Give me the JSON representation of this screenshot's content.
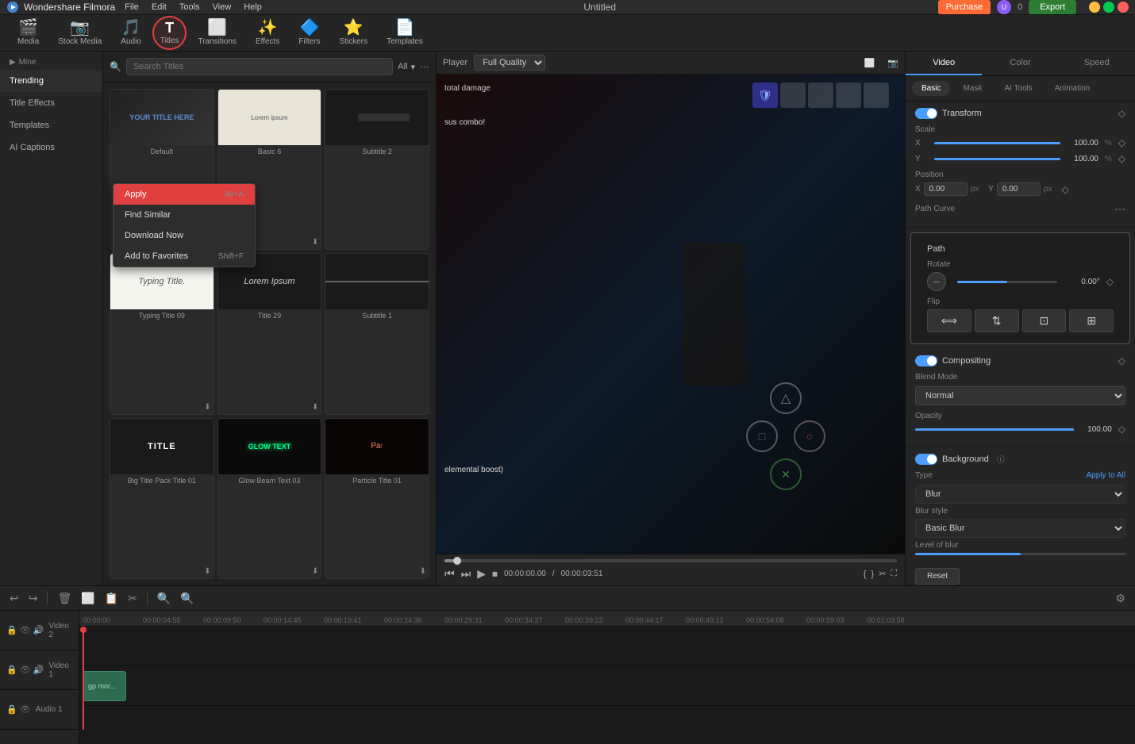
{
  "app": {
    "name": "Wondershare Filmora",
    "title": "Untitled",
    "purchase_label": "Purchase",
    "export_label": "Export"
  },
  "topbar_menus": [
    "File",
    "Edit",
    "Tools",
    "View",
    "Help"
  ],
  "toolbar": {
    "items": [
      {
        "id": "media",
        "label": "Media",
        "icon": "🎬"
      },
      {
        "id": "stock",
        "label": "Stock Media",
        "icon": "📷"
      },
      {
        "id": "audio",
        "label": "Audio",
        "icon": "🎵"
      },
      {
        "id": "titles",
        "label": "Titles",
        "icon": "T",
        "active": true
      },
      {
        "id": "transitions",
        "label": "Transitions",
        "icon": "⬛"
      },
      {
        "id": "effects",
        "label": "Effects",
        "icon": "✨"
      },
      {
        "id": "filters",
        "label": "Filters",
        "icon": "🔷"
      },
      {
        "id": "stickers",
        "label": "Stickers",
        "icon": "⭐"
      },
      {
        "id": "templates",
        "label": "Templates",
        "icon": "📄"
      }
    ]
  },
  "left_panel": {
    "sections": [
      {
        "id": "mine",
        "label": "Mine",
        "expandable": true
      },
      {
        "id": "trending",
        "label": "Trending",
        "active": true
      },
      {
        "id": "title_effects",
        "label": "Title Effects"
      },
      {
        "id": "title_templates",
        "label": "Templates"
      },
      {
        "id": "ai_captions",
        "label": "AI Captions"
      }
    ]
  },
  "titles_panel": {
    "search_placeholder": "Search Titles",
    "filter_label": "All",
    "cards": [
      {
        "id": "default",
        "label": "Default",
        "type": "default"
      },
      {
        "id": "basic6",
        "label": "Basic 6",
        "type": "basic6"
      },
      {
        "id": "subtitle2",
        "label": "Subtitle 2",
        "type": "subtitle2"
      },
      {
        "id": "typing09",
        "label": "Typing Title 09",
        "type": "typing"
      },
      {
        "id": "title29",
        "label": "Title 29",
        "type": "title29"
      },
      {
        "id": "subtitle1",
        "label": "Subtitle 1",
        "type": "subtitle1"
      },
      {
        "id": "big_title01",
        "label": "Big Title Pack Title 01",
        "type": "bigTitle"
      },
      {
        "id": "glow_beam03",
        "label": "Glow Beam Text 03",
        "type": "glow"
      },
      {
        "id": "particle01",
        "label": "Particle Title 01",
        "type": "particle"
      }
    ]
  },
  "context_menu": {
    "items": [
      {
        "id": "apply",
        "label": "Apply",
        "shortcut": "Alt+A",
        "style": "primary"
      },
      {
        "id": "find_similar",
        "label": "Find Similar",
        "shortcut": ""
      },
      {
        "id": "download",
        "label": "Download Now",
        "shortcut": ""
      },
      {
        "id": "favorites",
        "label": "Add to Favorites",
        "shortcut": "Shift+F"
      }
    ]
  },
  "player": {
    "label": "Player",
    "quality": "Full Quality",
    "current_time": "00:00:00.00",
    "total_time": "00:00:03:51"
  },
  "right_panel": {
    "tabs": [
      "Video",
      "Color",
      "Speed"
    ],
    "active_tab": "Video",
    "sub_tabs": [
      "Basic",
      "Mask",
      "AI Tools",
      "Animation"
    ],
    "active_sub_tab": "Basic",
    "transform": {
      "title": "Transform",
      "scale": {
        "label": "Scale",
        "x_label": "X",
        "x_value": "100.00",
        "x_unit": "%",
        "y_label": "Y",
        "y_value": "100.00",
        "y_unit": "%"
      },
      "position": {
        "label": "Position",
        "x_label": "X",
        "x_value": "0.00",
        "x_unit": "px",
        "y_label": "Y",
        "y_value": "0.00",
        "y_unit": "px"
      },
      "path_curve_label": "Path Curve"
    },
    "path_section": {
      "title": "Path",
      "rotate": {
        "label": "Rotate",
        "value": "0.00°"
      },
      "flip_label": "Flip"
    },
    "compositing": {
      "title": "Compositing",
      "blend_mode_label": "Blend Mode",
      "blend_mode_value": "Normal",
      "opacity_label": "Opacity",
      "opacity_value": "100.00"
    },
    "background": {
      "title": "Background",
      "enabled": true,
      "type_label": "Type",
      "apply_all_label": "Apply to All",
      "type_value": "Blur",
      "blur_style_label": "Blur style",
      "blur_style_value": "Basic Blur",
      "blur_level_label": "Level of blur",
      "reset_label": "Reset"
    }
  },
  "timeline": {
    "tracks": [
      {
        "id": "video2",
        "label": "Video 2",
        "clips": []
      },
      {
        "id": "video1",
        "label": "Video 1",
        "clips": [
          {
            "label": "gp mor...",
            "start": 0,
            "width": 60
          }
        ]
      },
      {
        "id": "audio1",
        "label": "Audio 1",
        "clips": []
      }
    ],
    "time_markers": [
      "00:00:00",
      "00:00:04:55",
      "00:00:09:50",
      "00:00:14:45",
      "00:00:19:41",
      "00:00:24:36",
      "00:00:29:31",
      "00:00:34:27",
      "00:00:39:22",
      "00:00:44:17",
      "00:00:49:12",
      "00:00:54:08",
      "00:00:59:03",
      "00:01:03:58"
    ]
  }
}
